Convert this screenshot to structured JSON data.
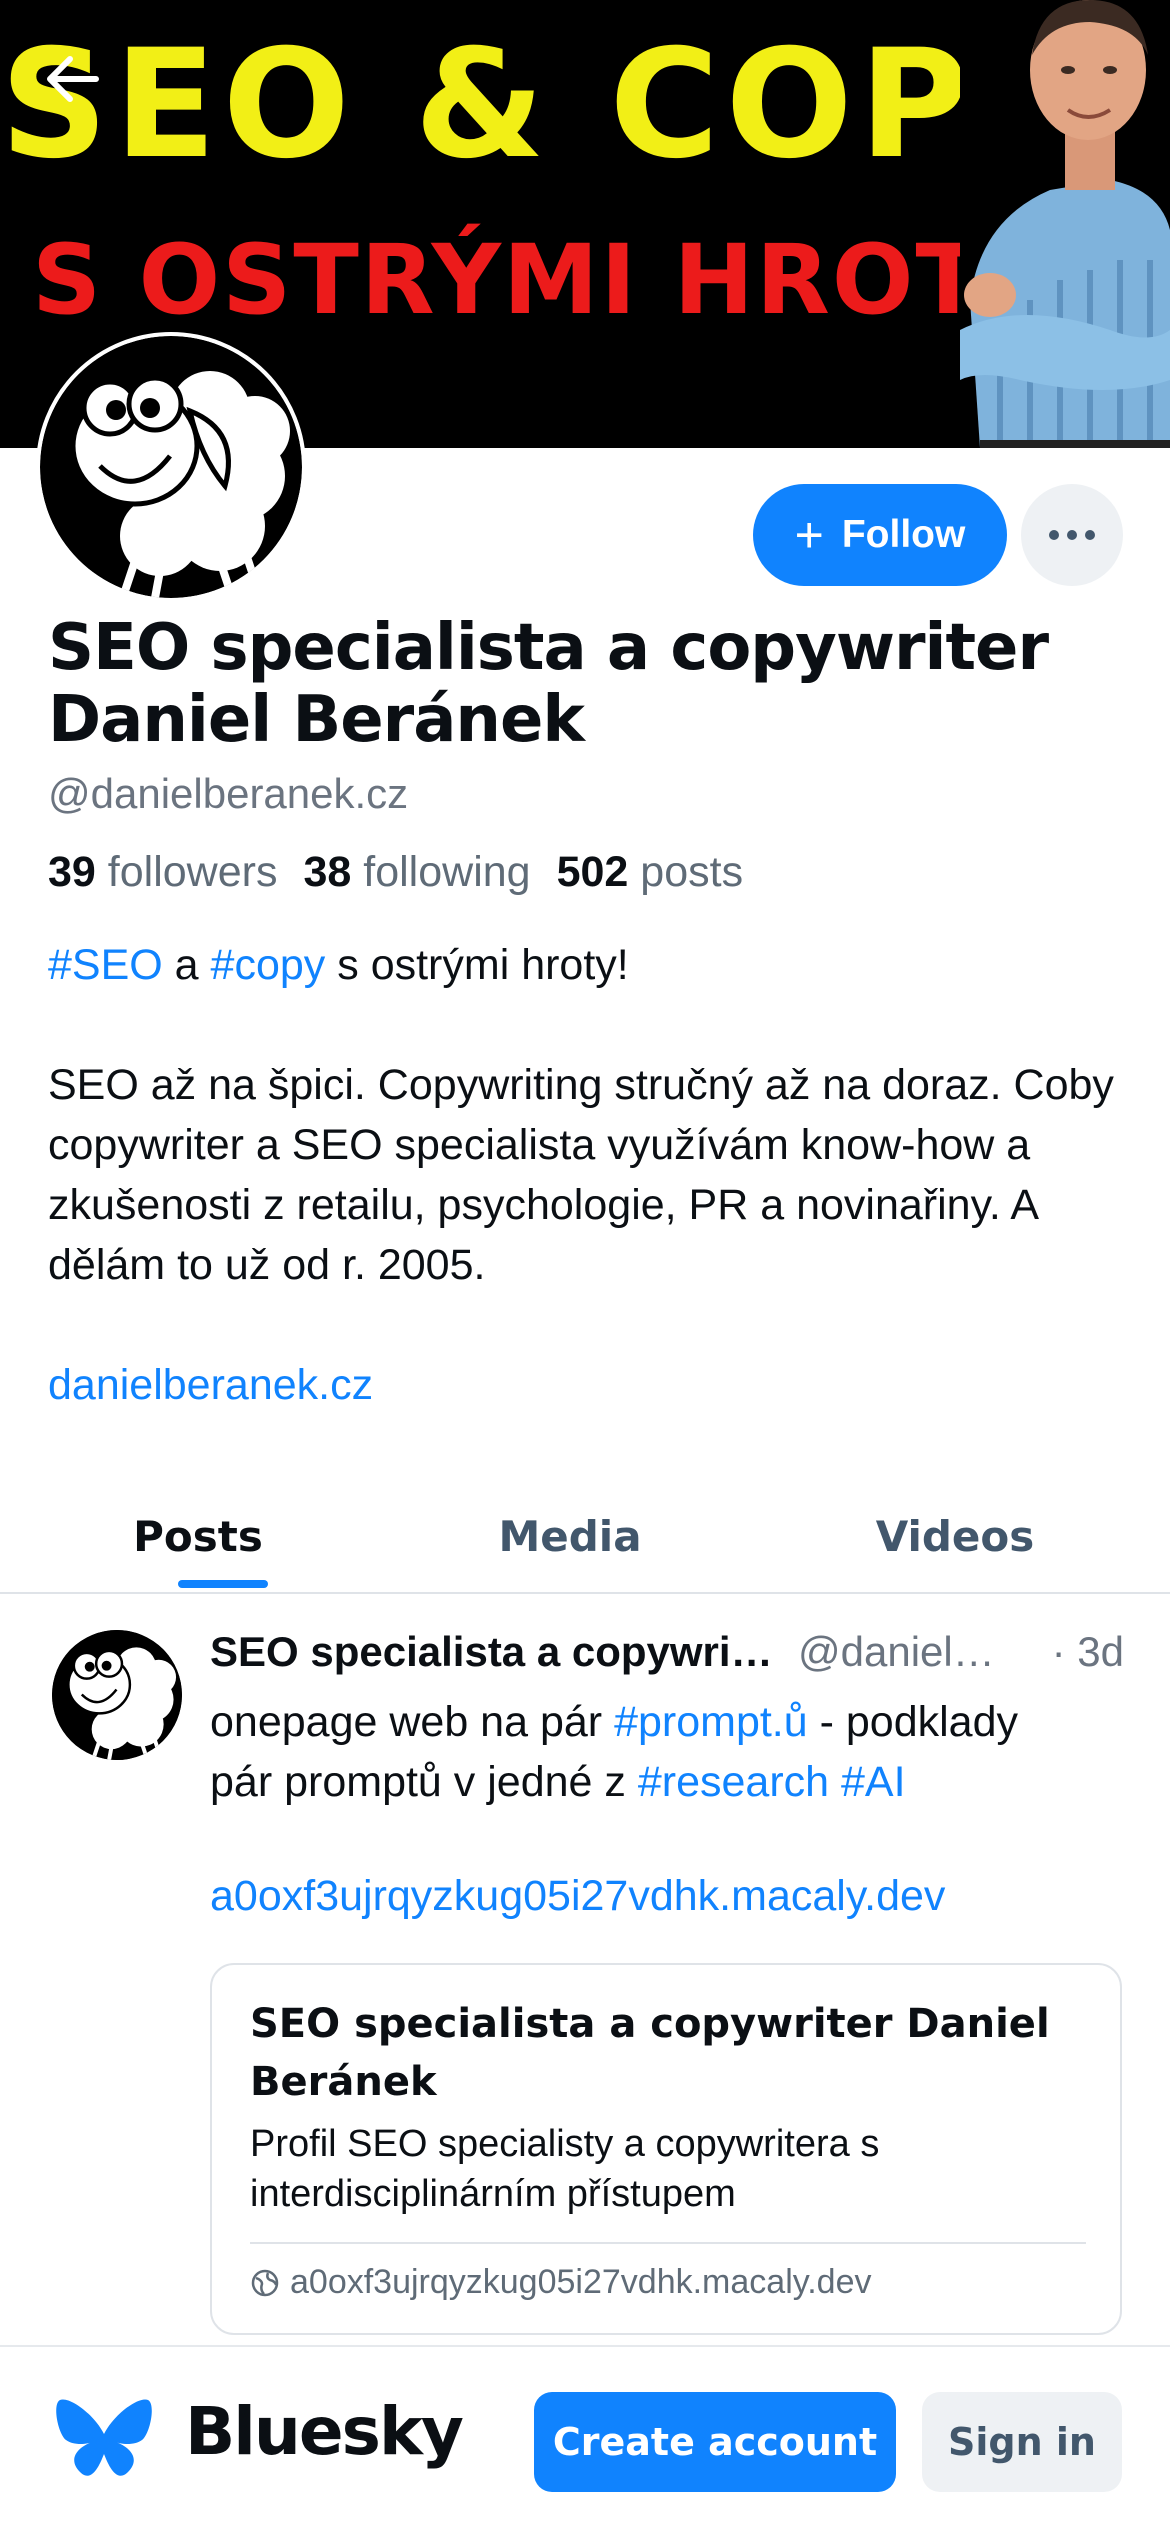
{
  "banner": {
    "line1": "SEO & COPY",
    "line2": "S OSTRÝMI HROTY"
  },
  "profile": {
    "display_name": "SEO specialista a copywriter Daniel Beránek",
    "handle": "@danielberanek.cz",
    "follow_label": "Follow",
    "stats": {
      "followers_count": "39",
      "followers_label": "followers",
      "following_count": "38",
      "following_label": "following",
      "posts_count": "502",
      "posts_label": "posts"
    },
    "bio": {
      "tag1": "#SEO",
      "and": " a ",
      "tag2": "#copy",
      "rest1": " s ostrými hroty!",
      "paragraph": "SEO až na špici. Copywriting stručný až na doraz. Coby copywriter a SEO specialista využívám know-how a zkušenosti z retailu, psychologie, PR a novinařiny. A dělám to už od r. 2005.",
      "website": "danielberanek.cz"
    }
  },
  "tabs": [
    {
      "label": "Posts",
      "active": true
    },
    {
      "label": "Media",
      "active": false
    },
    {
      "label": "Videos",
      "active": false
    }
  ],
  "post": {
    "author": "SEO specialista a copywriter Daniel Beránek",
    "handle": "@danielberanek.cz",
    "time": "· 3d",
    "text1_a": "onepage web na pár ",
    "tag_prompt": "#prompt.ů",
    "text1_b": " - podklady",
    "text2_a": "pár promptů v jedné z ",
    "tag_research": "#research",
    "space": " ",
    "tag_ai": "#AI",
    "link": "a0oxf3ujrqyzkug05i27vdhk.macaly.dev",
    "card": {
      "title": "SEO specialista a copywriter Daniel Beránek",
      "description": "Profil SEO specialisty a copywritera s interdisciplinárním přístupem",
      "domain": "a0oxf3ujrqyzkug05i27vdhk.macaly.dev"
    }
  },
  "bottom_bar": {
    "brand": "Bluesky",
    "create_account": "Create account",
    "sign_in": "Sign in"
  },
  "colors": {
    "accent": "#1083fe",
    "banner_yellow": "#f2ef16",
    "banner_red": "#ec1b1b",
    "muted_text": "#6b7480"
  },
  "icons": [
    "back-arrow-icon",
    "plus-icon",
    "ellipsis-icon",
    "globe-icon",
    "bluesky-butterfly-icon"
  ]
}
